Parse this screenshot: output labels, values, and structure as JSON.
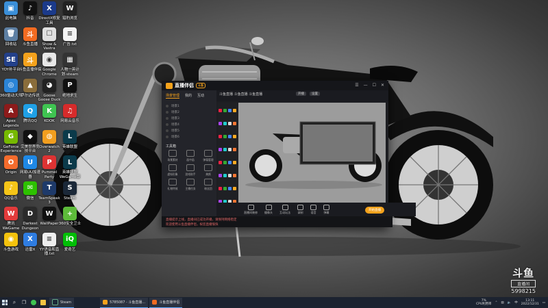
{
  "desktop_icons": [
    {
      "label": "此电脑",
      "color": "#3b8fd8",
      "glyph": "▣"
    },
    {
      "label": "抖音",
      "color": "#111111",
      "glyph": "♪"
    },
    {
      "label": "DirectX修复\n工具",
      "color": "#1b3a8a",
      "glyph": "X"
    },
    {
      "label": "猎豹浏览",
      "color": "#222222",
      "glyph": "W"
    },
    {
      "label": "回收站",
      "color": "#5d7fa3",
      "glyph": "🗑"
    },
    {
      "label": "斗鱼直播",
      "color": "#f26b21",
      "glyph": "斗"
    },
    {
      "label": "Show & \nVastra",
      "color": "#e0e0e0",
      "glyph": "☐"
    },
    {
      "label": "广告.txt",
      "color": "#f4f4f4",
      "glyph": "≡"
    },
    {
      "label": "YOY补平台",
      "color": "#23408a",
      "glyph": "SE"
    },
    {
      "label": "斗鱼直播伴侣",
      "color": "#f4a21c",
      "glyph": "斗"
    },
    {
      "label": "Google\nChrome",
      "color": "#e8e8e8",
      "glyph": "◉"
    },
    {
      "label": "人物一英计\n划·steam",
      "color": "#333333",
      "glyph": "▦"
    },
    {
      "label": "360驱动大师",
      "color": "#2b84d6",
      "glyph": "◎"
    },
    {
      "label": "萨尔达传说",
      "color": "#8a6d3b",
      "glyph": "▲"
    },
    {
      "label": "Goose\nGoose Duck",
      "color": "#222222",
      "glyph": "◕"
    },
    {
      "label": "绝地求生",
      "color": "#111111",
      "glyph": "P"
    },
    {
      "label": "Apex\nLegends",
      "color": "#8c1b1b",
      "glyph": "A"
    },
    {
      "label": "腾讯QQ",
      "color": "#1fa0e6",
      "glyph": "Q"
    },
    {
      "label": "KOOK",
      "color": "#3fc451",
      "glyph": "K"
    },
    {
      "label": "网易云音乐",
      "color": "#d62b2b",
      "glyph": "♫"
    },
    {
      "label": "GeForce\nExperience",
      "color": "#76b900",
      "glyph": "G"
    },
    {
      "label": "完美世界竞\n技平台",
      "color": "#111111",
      "glyph": "◆"
    },
    {
      "label": "Overwatch\n2",
      "color": "#f29e1f",
      "glyph": "◍"
    },
    {
      "label": "英雄联盟",
      "color": "#0b3a4a",
      "glyph": "L"
    },
    {
      "label": "Origin",
      "color": "#f56c2d",
      "glyph": "O"
    },
    {
      "label": "网易UU加速\n器",
      "color": "#1e88e5",
      "glyph": "U"
    },
    {
      "label": "Pummel\nParty",
      "color": "#d33",
      "glyph": "P"
    },
    {
      "label": "英雄联盟\nWeGame版",
      "color": "#0b3a4a",
      "glyph": "L"
    },
    {
      "label": "QQ音乐",
      "color": "#f5c518",
      "glyph": "♪"
    },
    {
      "label": "微信",
      "color": "#2dc100",
      "glyph": "✉"
    },
    {
      "label": "TeamSpeak\n3",
      "color": "#1e3a6a",
      "glyph": "T"
    },
    {
      "label": "Steam",
      "color": "#1b2838",
      "glyph": "S"
    },
    {
      "label": "腾讯WeGame",
      "color": "#e23b3b",
      "glyph": "W"
    },
    {
      "label": "Darkest\nDungeon",
      "color": "#2a2a2a",
      "glyph": "D"
    },
    {
      "label": "WallPaper",
      "color": "#111111",
      "glyph": "W"
    },
    {
      "label": "360安全卫士",
      "color": "#5dbb3a",
      "glyph": "+"
    },
    {
      "label": "斗鱼游戏",
      "color": "#f4c20d",
      "glyph": "◉"
    },
    {
      "label": "迅雷X",
      "color": "#2f7de1",
      "glyph": "X"
    },
    {
      "label": "YY语音和直\n播.txt",
      "color": "#eeeeee",
      "glyph": "≡"
    },
    {
      "label": "爱奇艺",
      "color": "#00be06",
      "glyph": "iQ"
    }
  ],
  "app": {
    "logo": "直播伴侣",
    "version_tag": "斗鱼",
    "window_buttons": [
      "☰",
      "—",
      "☐",
      "✕"
    ],
    "sidebar_tabs": [
      "场景管理",
      "我的",
      "互动"
    ],
    "scenes": [
      "场景1",
      "场景2",
      "场景3",
      "场景4",
      "场景5",
      "场景6"
    ],
    "tools_title": "工具箱",
    "tools": [
      "场景素材",
      "画中画",
      "弹幕管理",
      "虚拟形象",
      "游戏助手",
      "美颜",
      "礼物特效",
      "主播任务",
      "粉丝团"
    ],
    "top_title": "斗鱼直播 斗鱼直播 斗鱼直播",
    "top_btn1": "开播",
    "top_btn2": "设置",
    "bottom_tools": [
      "直播间装修",
      "摄像头",
      "互动玩法",
      "录制",
      "语音",
      "弹幕"
    ],
    "live_button": "开始直播",
    "status_line1": "直播提示上线，直播间已成功开播，请保持网络稳定",
    "status_line2": "欢迎使用斗鱼直播伴侣，祝您直播愉快"
  },
  "watermark": {
    "logo": "斗鱼",
    "sub": "直播间",
    "room": "5998215"
  },
  "taskbar": {
    "tasks": [
      {
        "label": "Steam",
        "color": "#1b2838"
      },
      {
        "label": "5785087 - 斗鱼直播...",
        "color": "#f4a21c"
      },
      {
        "label": "斗鱼直播伴侣",
        "color": "#f26b21"
      }
    ],
    "cpu_line1": "7%",
    "cpu_line2": "CPU利用率",
    "time": "13:11",
    "date": "2022/12/31"
  }
}
